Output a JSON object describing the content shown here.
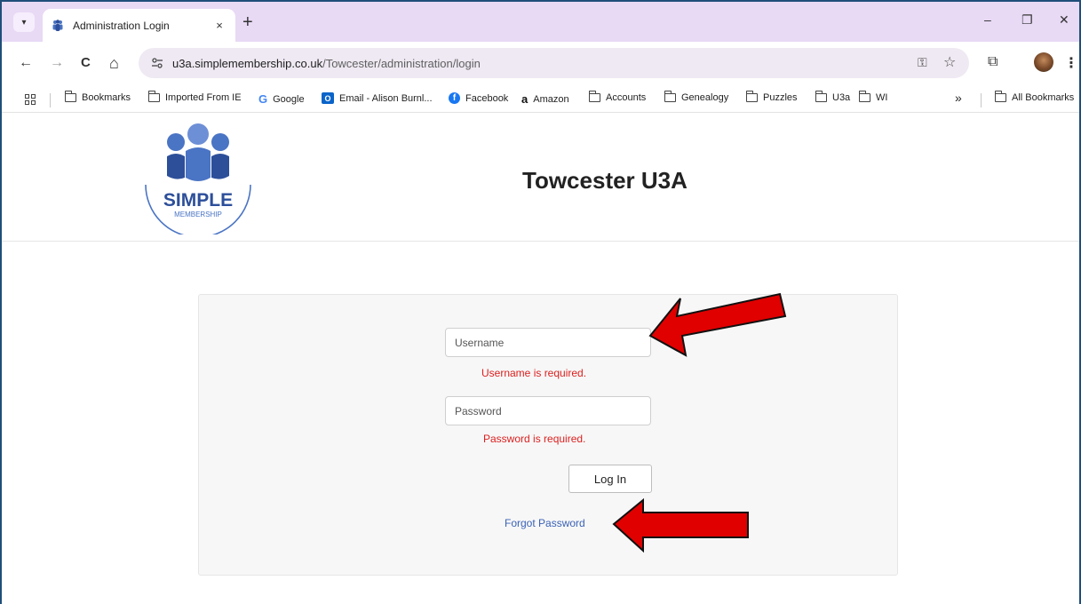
{
  "browser": {
    "tab": {
      "title": "Administration Login",
      "close": "×"
    },
    "new_tab": "+",
    "window": {
      "minimize": "–",
      "restore": "❐",
      "close": "✕"
    },
    "toolbar": {
      "back": "←",
      "forward": "→",
      "reload": "C",
      "home": "⌂",
      "url_host": "u3a.simplemembership.co.uk",
      "url_path": "/Towcester/administration/login",
      "key_icon": "⚿",
      "star_icon": "☆",
      "ext_icon": "⧉",
      "menu_icon": "⋮"
    },
    "bookmarks": {
      "items": [
        "Bookmarks",
        "Imported From IE",
        "Google",
        "Email - Alison Burnl...",
        "Facebook",
        "Amazon",
        "Accounts",
        "Genealogy",
        "Puzzles",
        "U3a",
        "WI"
      ],
      "overflow": "»",
      "all_bookmarks": "All Bookmarks"
    }
  },
  "page": {
    "logo": {
      "word": "SIMPLE",
      "sub": "MEMBERSHIP"
    },
    "title": "Towcester U3A",
    "login": {
      "username_placeholder": "Username",
      "username_error": "Username is required.",
      "password_placeholder": "Password",
      "password_error": "Password is required.",
      "login_button": "Log In",
      "forgot_link": "Forgot Password"
    }
  },
  "colors": {
    "tabstrip": "#e8d9f5",
    "error": "#dc1f1f",
    "link": "#3a62b6",
    "arrow_fill": "#e00000",
    "logo_blue": "#4a74c4"
  }
}
